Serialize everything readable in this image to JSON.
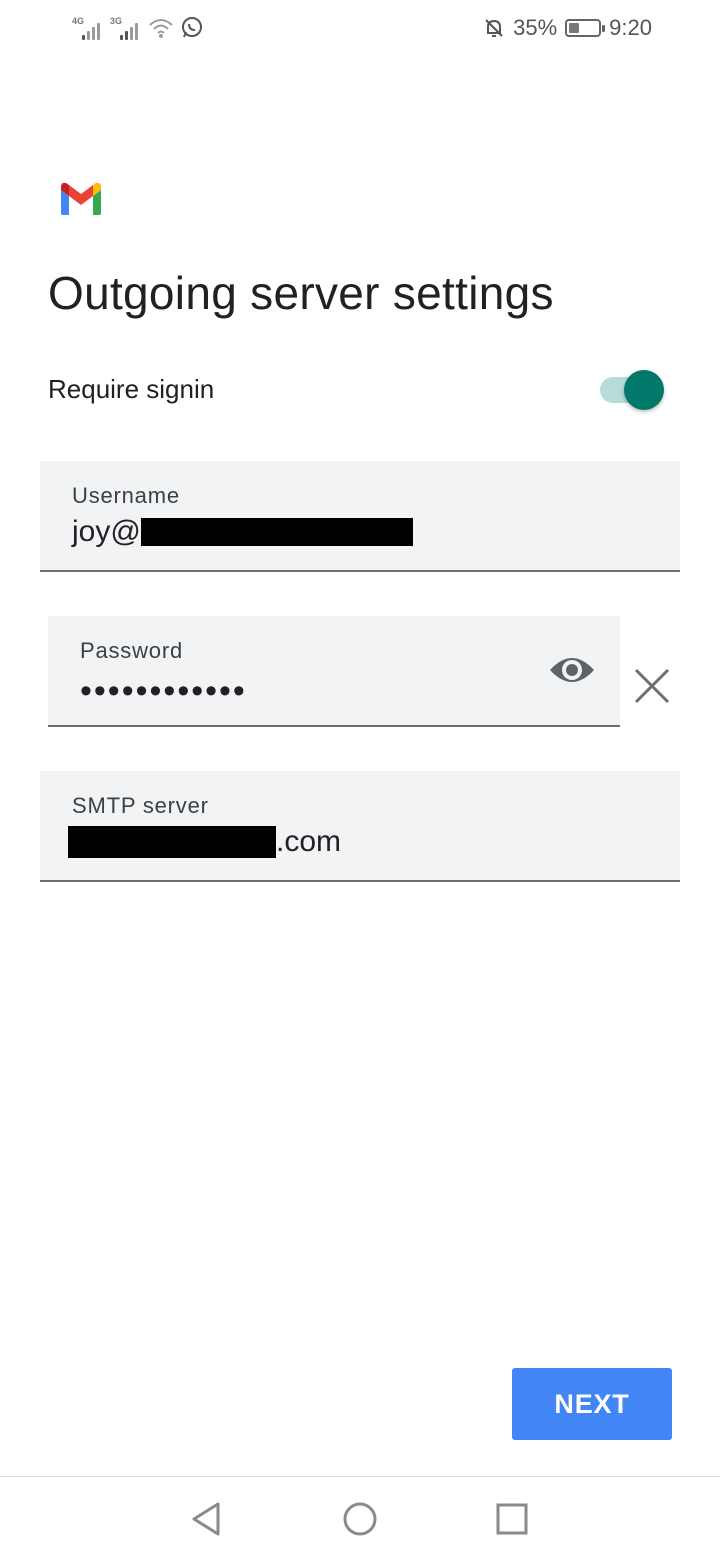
{
  "status_bar": {
    "network_1": "4G",
    "network_2": "3G",
    "battery_percent": "35%",
    "battery_level": 0.35,
    "time": "9:20",
    "icons": [
      "signal-icon",
      "wifi-icon",
      "whatsapp-icon",
      "mute-bell-icon",
      "battery-icon"
    ]
  },
  "app": {
    "logo_icon": "gmail-logo",
    "title": "Outgoing server settings"
  },
  "require_signin": {
    "label": "Require signin",
    "enabled": true
  },
  "username": {
    "label": "Username",
    "value_visible_prefix": "joy@"
  },
  "password": {
    "label": "Password",
    "masked_value": "••••••••••••",
    "show_icon": "eye-icon",
    "clear_icon": "close-icon"
  },
  "smtp_server": {
    "label": "SMTP server",
    "value_visible_suffix": ".com"
  },
  "actions": {
    "next_label": "NEXT"
  },
  "colors": {
    "accent_teal": "#00796b",
    "button_blue": "#4285f4",
    "field_background": "#f1f3f4"
  },
  "nav_bar": {
    "icons": [
      "back-icon",
      "home-icon",
      "recents-icon"
    ]
  }
}
